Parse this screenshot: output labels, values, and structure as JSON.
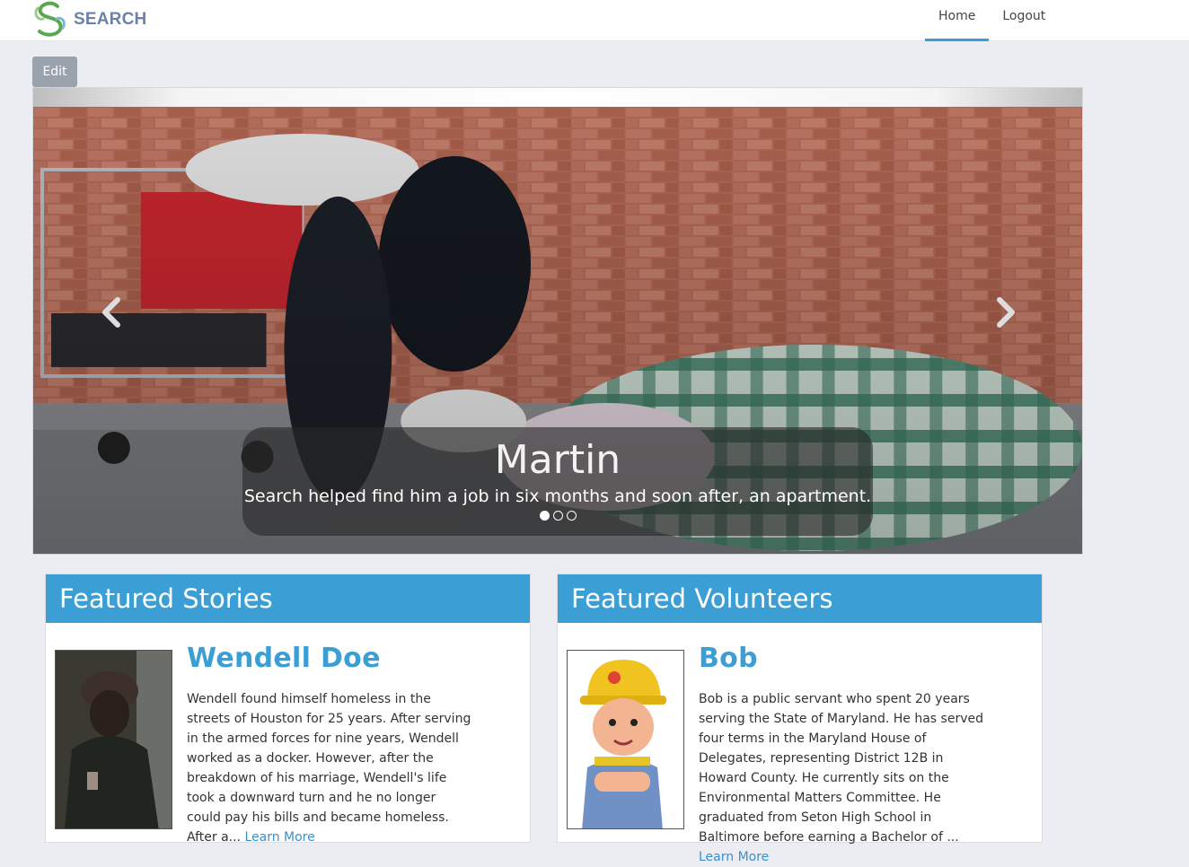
{
  "brand": {
    "name": "SEARCH",
    "text_color": "#6a82a8",
    "accent": "#5aa84c"
  },
  "nav": {
    "items": [
      {
        "label": "Home",
        "active": true
      },
      {
        "label": "Logout",
        "active": false
      }
    ]
  },
  "toolbar": {
    "edit_label": "Edit"
  },
  "carousel": {
    "slide_title": "Martin",
    "slide_text": "Search helped find him a job in six months and soon after, an apartment.",
    "slide_count": 3,
    "active_slide": 1
  },
  "stories": {
    "header": "Featured Stories",
    "name": "Wendell Doe",
    "bio": "Wendell found himself homeless in the streets of Houston for 25 years. After serving in the armed forces for nine years, Wendell worked as a docker. However, after the breakdown of his marriage, Wendell's life took a downward turn and he no longer could pay his bills and became homeless. After a...",
    "link": "Learn More"
  },
  "volunteers": {
    "header": "Featured Volunteers",
    "name": "Bob",
    "bio": "Bob is a public servant who spent 20 years serving the State of Maryland. He has served four terms in the Maryland House of Delegates, representing District 12B in Howard County. He currently sits on the Environmental Matters Committee. He graduated from Seton High School in Baltimore before earning a Bachelor of ...",
    "link": "Learn More"
  },
  "colors": {
    "primary": "#3b9fd5",
    "background": "#ecedf2"
  }
}
